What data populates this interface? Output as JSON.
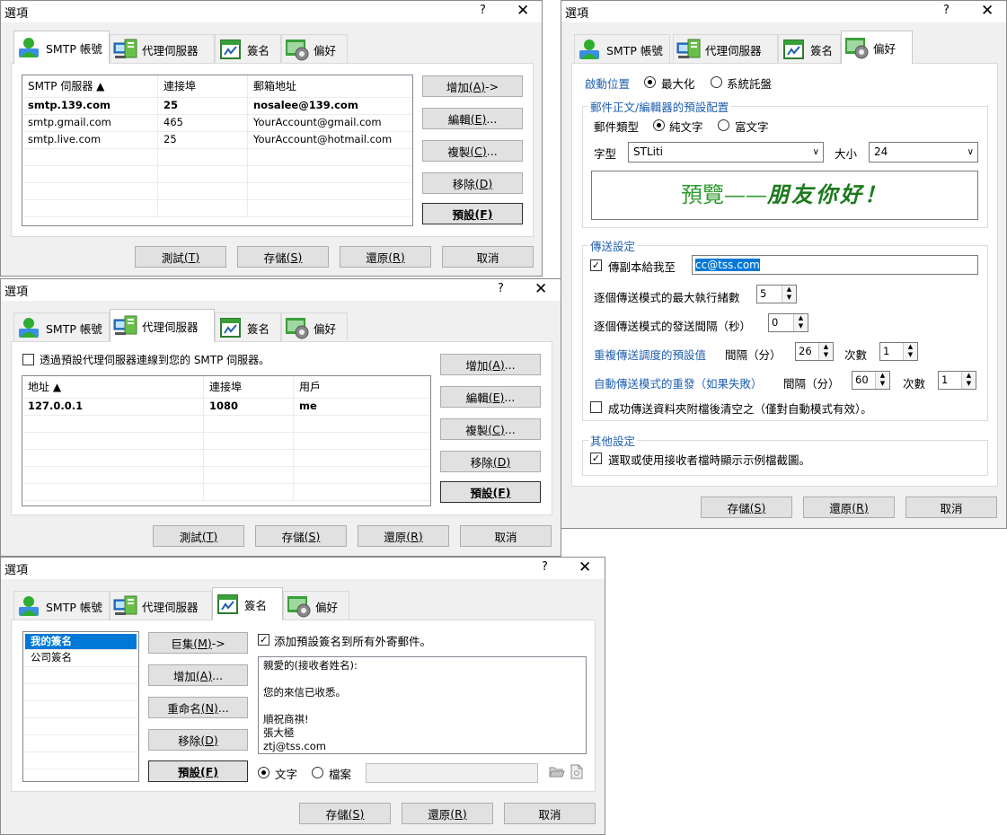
{
  "dialog_title": "選項",
  "help_glyph": "?",
  "close_glyph": "✕",
  "tabs": {
    "smtp": "SMTP 帳號",
    "proxy": "代理伺服器",
    "signature": "簽名",
    "preference": "偏好"
  },
  "buttons": {
    "test_label": "測試",
    "test_key": "(T)",
    "save_label": "存儲",
    "save_key": "(S)",
    "restore_label": "還原",
    "restore_key": "(R)",
    "cancel": "取消",
    "add_label": "增加",
    "add_key": "(A)",
    "edit_label": "編輯",
    "edit_key": "(E)",
    "copy_label": "複製",
    "copy_key": "(C)",
    "remove_label": "移除",
    "remove_key": "(D)",
    "default_label": "預設",
    "default_key": "(F)",
    "add_arrow_suffix": " ->",
    "ellipsis": "..."
  },
  "smtp": {
    "columns": [
      "SMTP 伺服器 ▲",
      "連接埠",
      "郵箱地址"
    ],
    "rows": [
      {
        "server": "smtp.139.com",
        "port": "25",
        "email": "nosalee@139.com",
        "bold": true
      },
      {
        "server": "smtp.gmail.com",
        "port": "465",
        "email": "YourAccount@gmail.com",
        "bold": false
      },
      {
        "server": "smtp.live.com",
        "port": "25",
        "email": "YourAccount@hotmail.com",
        "bold": false
      }
    ]
  },
  "proxy": {
    "use_proxy_label": "透過預設代理伺服器連線到您的 SMTP 伺服器。",
    "use_proxy_checked": false,
    "columns": [
      "地址 ▲",
      "連接埠",
      "用戶"
    ],
    "rows": [
      {
        "address": "127.0.0.1",
        "port": "1080",
        "user": "me",
        "bold": true
      }
    ]
  },
  "signature": {
    "macro_label": "巨集",
    "macro_key": "(M)",
    "rename_label": "重命名",
    "rename_key": "(N)",
    "list": [
      "我的簽名",
      "公司簽名"
    ],
    "selected": "我的簽名",
    "add_default_label": "添加預設簽名到所有外寄郵件。",
    "add_default_checked": true,
    "body": "親愛的(接收者姓名):\n\n您的來信已收悉。\n\n順祝商祺!\n張大極\nztj@tss.com",
    "source_text": "文字",
    "source_file": "檔案",
    "source_selected": "文字",
    "file_path": ""
  },
  "preference": {
    "startup_label": "啟動位置",
    "startup_max": "最大化",
    "startup_tray": "系統託盤",
    "startup_selected": "最大化",
    "editor_group": "郵件正文/編輯器的預設配置",
    "mail_type_label": "郵件類型",
    "mail_plain": "純文字",
    "mail_rich": "富文字",
    "mail_selected": "純文字",
    "font_label": "字型",
    "font_value": "STLiti",
    "size_label": "大小",
    "size_value": "24",
    "preview_label": "預覽",
    "preview_dash": "——",
    "preview_sample": "朋友你好！",
    "send_group": "傳送設定",
    "cc_label": "傳副本給我至",
    "cc_checked": true,
    "cc_value": "cc@tss.com",
    "max_threads_label": "逐個傳送模式的最大執行緒數",
    "max_threads_value": "5",
    "interval_label": "逐個傳送模式的發送間隔（秒）",
    "interval_value": "0",
    "resend_label": "重複傳送調度的預設值",
    "resend_interval_label": "間隔（分）",
    "resend_interval_value": "26",
    "resend_count_label": "次數",
    "resend_count_value": "1",
    "auto_resend_label": "自動傳送模式的重發（如果失敗）",
    "auto_interval_label": "間隔（分）",
    "auto_interval_value": "60",
    "auto_count_label": "次數",
    "auto_count_value": "1",
    "clear_folder_label": "成功傳送資料夾附檔後清空之（僅對自動模式有效）。",
    "clear_folder_checked": false,
    "other_group": "其他設定",
    "screenshot_label": "選取或使用接收者檔時顯示示例檔截圖。",
    "screenshot_checked": true
  },
  "colors": {
    "section_heading": "#1f5fb0",
    "selection": "#0078d7",
    "preview_text": "#2f9a2f"
  }
}
